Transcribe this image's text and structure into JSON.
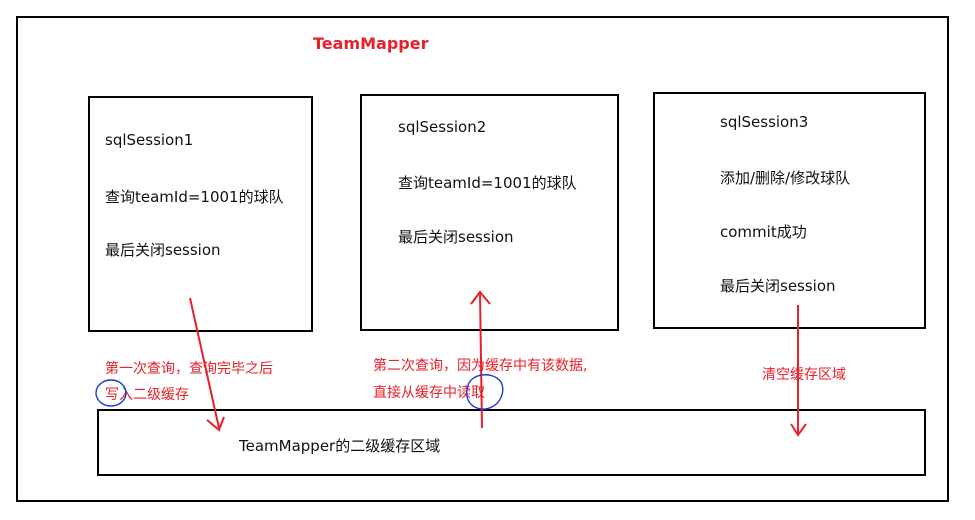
{
  "title": "TeamMapper",
  "sessions": [
    {
      "name": "sqlSession1",
      "lines": [
        "查询teamId=1001的球队",
        "最后关闭session"
      ]
    },
    {
      "name": "sqlSession2",
      "lines": [
        "查询teamId=1001的球队",
        "最后关闭session"
      ]
    },
    {
      "name": "sqlSession3",
      "lines": [
        "添加/删除/修改球队",
        "commit成功",
        "最后关闭session"
      ]
    }
  ],
  "notes": {
    "session1_line1": "第一次查询，查询完毕之后",
    "session1_line2": "写入二级缓存",
    "session2_line1": "第二次查询，因为缓存中有该数据,",
    "session2_line2": "直接从缓存中读取",
    "session3": "清空缓存区域"
  },
  "cache_label": "TeamMapper的二级缓存区域",
  "colors": {
    "annotation": "#e8202a",
    "circle": "#1a3fd1",
    "border": "#000000"
  }
}
